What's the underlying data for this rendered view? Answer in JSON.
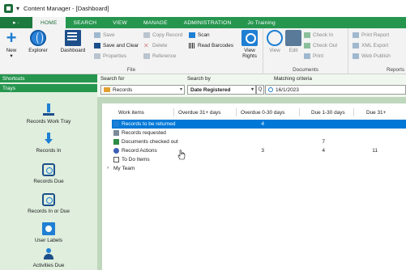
{
  "titlebar": {
    "quick_access": "▾",
    "title": "Content Manager - [Dashboard]"
  },
  "tabs": {
    "file": "▸ ·",
    "items": [
      "HOME",
      "SEARCH",
      "VIEW",
      "MANAGE",
      "ADMINISTRATION",
      "Jo Training"
    ],
    "active": "HOME"
  },
  "ribbon": {
    "file_group": {
      "label": "File",
      "new": "New",
      "explorer": "Explorer",
      "dashboard": "Dashboard",
      "save": "Save",
      "save_and_clear": "Save and Clear",
      "properties": "Properties",
      "copy_record": "Copy Record",
      "delete": "Delete",
      "reference": "Reference",
      "scan": "Scan",
      "read_barcodes": "Read Barcodes",
      "view_rights": "View Rights"
    },
    "documents_group": {
      "label": "Documents",
      "view": "View",
      "edit": "Edit",
      "check_in": "Check In",
      "check_out": "Check Out",
      "print": "Print"
    },
    "reports_group": {
      "label": "Reports",
      "print_report": "Print Report",
      "xml_export": "XML Export",
      "web_publish": "Web Publish"
    }
  },
  "left_pane": {
    "shortcuts_header": "Shortcuts",
    "trays_header": "Trays",
    "trays": [
      {
        "label": "Records Work Tray",
        "icon": "work-tray-icon"
      },
      {
        "label": "Records In",
        "icon": "records-in-icon"
      },
      {
        "label": "Records Due",
        "icon": "records-due-icon"
      },
      {
        "label": "Records In or Due",
        "icon": "records-in-or-due-icon"
      },
      {
        "label": "User Labels",
        "icon": "user-labels-icon"
      },
      {
        "label": "Activities Due",
        "icon": "activities-due-icon"
      }
    ]
  },
  "search": {
    "search_for_label": "Search for",
    "search_for_value": "Records",
    "search_by_label": "Search by",
    "search_by_value": "Date Registered",
    "criteria_label": "Matching criteria",
    "query_button": "Q",
    "criteria_value": "16/1/2023"
  },
  "work_items": {
    "headers": [
      "Work items",
      "Overdue 31+ days",
      "Overdue 0-30 days",
      "Due 1-30 days",
      "Due 31+"
    ],
    "rows": [
      {
        "name": "Records to be returned",
        "overdue31": "4",
        "overdue0": "",
        "due1": "",
        "due31": "",
        "icon": "return-icon",
        "selected": true
      },
      {
        "name": "Records requested",
        "overdue31": "",
        "overdue0": "",
        "due1": "",
        "due31": "",
        "icon": "request-icon",
        "selected": false
      },
      {
        "name": "Documents checked out",
        "overdue31": "",
        "overdue0": "7",
        "due1": "",
        "due31": "",
        "icon": "checked-out-icon",
        "selected": false
      },
      {
        "name": "Record Actions",
        "overdue31": "3",
        "overdue0": "4",
        "due1": "11",
        "due31": "",
        "icon": "actions-icon",
        "selected": false
      },
      {
        "name": "To Do Items",
        "overdue31": "",
        "overdue0": "",
        "due1": "",
        "due31": "",
        "icon": "todo-icon",
        "selected": false
      }
    ],
    "team": "My Team",
    "team_caret": "›"
  },
  "colors": {
    "brand_green": "#26964f",
    "selection_blue": "#0078d7",
    "pane_green": "#dfeedd"
  }
}
